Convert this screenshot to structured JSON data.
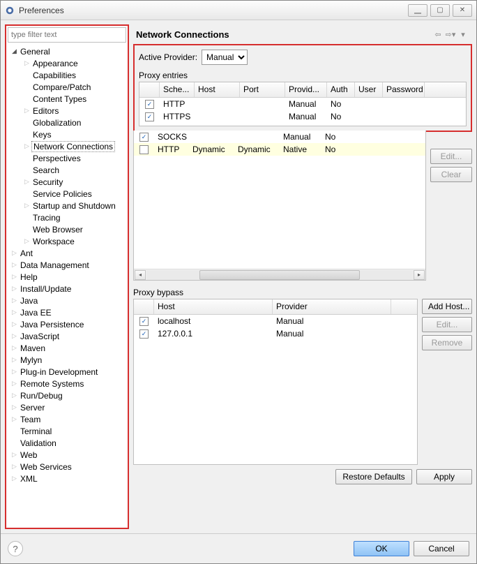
{
  "window": {
    "title": "Preferences"
  },
  "filter_placeholder": "type filter text",
  "tree": [
    {
      "label": "General",
      "depth": 0,
      "arrow": "down",
      "selected": false
    },
    {
      "label": "Appearance",
      "depth": 1,
      "arrow": "right",
      "selected": false
    },
    {
      "label": "Capabilities",
      "depth": 1,
      "arrow": "",
      "selected": false
    },
    {
      "label": "Compare/Patch",
      "depth": 1,
      "arrow": "",
      "selected": false
    },
    {
      "label": "Content Types",
      "depth": 1,
      "arrow": "",
      "selected": false
    },
    {
      "label": "Editors",
      "depth": 1,
      "arrow": "right",
      "selected": false
    },
    {
      "label": "Globalization",
      "depth": 1,
      "arrow": "",
      "selected": false
    },
    {
      "label": "Keys",
      "depth": 1,
      "arrow": "",
      "selected": false
    },
    {
      "label": "Network Connections",
      "depth": 1,
      "arrow": "right",
      "selected": true
    },
    {
      "label": "Perspectives",
      "depth": 1,
      "arrow": "",
      "selected": false
    },
    {
      "label": "Search",
      "depth": 1,
      "arrow": "",
      "selected": false
    },
    {
      "label": "Security",
      "depth": 1,
      "arrow": "right",
      "selected": false
    },
    {
      "label": "Service Policies",
      "depth": 1,
      "arrow": "",
      "selected": false
    },
    {
      "label": "Startup and Shutdown",
      "depth": 1,
      "arrow": "right",
      "selected": false
    },
    {
      "label": "Tracing",
      "depth": 1,
      "arrow": "",
      "selected": false
    },
    {
      "label": "Web Browser",
      "depth": 1,
      "arrow": "",
      "selected": false
    },
    {
      "label": "Workspace",
      "depth": 1,
      "arrow": "right",
      "selected": false
    },
    {
      "label": "Ant",
      "depth": 0,
      "arrow": "right",
      "selected": false
    },
    {
      "label": "Data Management",
      "depth": 0,
      "arrow": "right",
      "selected": false
    },
    {
      "label": "Help",
      "depth": 0,
      "arrow": "right",
      "selected": false
    },
    {
      "label": "Install/Update",
      "depth": 0,
      "arrow": "right",
      "selected": false
    },
    {
      "label": "Java",
      "depth": 0,
      "arrow": "right",
      "selected": false
    },
    {
      "label": "Java EE",
      "depth": 0,
      "arrow": "right",
      "selected": false
    },
    {
      "label": "Java Persistence",
      "depth": 0,
      "arrow": "right",
      "selected": false
    },
    {
      "label": "JavaScript",
      "depth": 0,
      "arrow": "right",
      "selected": false
    },
    {
      "label": "Maven",
      "depth": 0,
      "arrow": "right",
      "selected": false
    },
    {
      "label": "Mylyn",
      "depth": 0,
      "arrow": "right",
      "selected": false
    },
    {
      "label": "Plug-in Development",
      "depth": 0,
      "arrow": "right",
      "selected": false
    },
    {
      "label": "Remote Systems",
      "depth": 0,
      "arrow": "right",
      "selected": false
    },
    {
      "label": "Run/Debug",
      "depth": 0,
      "arrow": "right",
      "selected": false
    },
    {
      "label": "Server",
      "depth": 0,
      "arrow": "right",
      "selected": false
    },
    {
      "label": "Team",
      "depth": 0,
      "arrow": "right",
      "selected": false
    },
    {
      "label": "Terminal",
      "depth": 0,
      "arrow": "",
      "selected": false
    },
    {
      "label": "Validation",
      "depth": 0,
      "arrow": "",
      "selected": false
    },
    {
      "label": "Web",
      "depth": 0,
      "arrow": "right",
      "selected": false
    },
    {
      "label": "Web Services",
      "depth": 0,
      "arrow": "right",
      "selected": false
    },
    {
      "label": "XML",
      "depth": 0,
      "arrow": "right",
      "selected": false
    }
  ],
  "main": {
    "title": "Network Connections",
    "active_provider_label": "Active Provider:",
    "active_provider_value": "Manual",
    "proxy_entries_label": "Proxy entries",
    "proxy_cols": [
      "Sche...",
      "Host",
      "Port",
      "Provid...",
      "Auth",
      "User",
      "Password"
    ],
    "proxy_col_widths": [
      50,
      65,
      65,
      60,
      40,
      40,
      60
    ],
    "proxy_rows": [
      {
        "checked": true,
        "cells": [
          "HTTP",
          "",
          "",
          "Manual",
          "No",
          "",
          ""
        ],
        "highlight": false
      },
      {
        "checked": true,
        "cells": [
          "HTTPS",
          "",
          "",
          "Manual",
          "No",
          "",
          ""
        ],
        "highlight": false
      },
      {
        "checked": true,
        "cells": [
          "SOCKS",
          "",
          "",
          "Manual",
          "No",
          "",
          ""
        ],
        "highlight": false
      },
      {
        "checked": false,
        "cells": [
          "HTTP",
          "Dynamic",
          "Dynamic",
          "Native",
          "No",
          "",
          ""
        ],
        "highlight": true
      }
    ],
    "edit_label": "Edit...",
    "clear_label": "Clear",
    "bypass_label": "Proxy bypass",
    "bypass_cols": [
      "Host",
      "Provider"
    ],
    "bypass_col_widths": [
      170,
      170
    ],
    "bypass_rows": [
      {
        "checked": true,
        "cells": [
          "localhost",
          "Manual"
        ]
      },
      {
        "checked": true,
        "cells": [
          "127.0.0.1",
          "Manual"
        ]
      }
    ],
    "add_host_label": "Add Host...",
    "remove_label": "Remove",
    "restore_label": "Restore Defaults",
    "apply_label": "Apply"
  },
  "footer": {
    "ok": "OK",
    "cancel": "Cancel"
  }
}
